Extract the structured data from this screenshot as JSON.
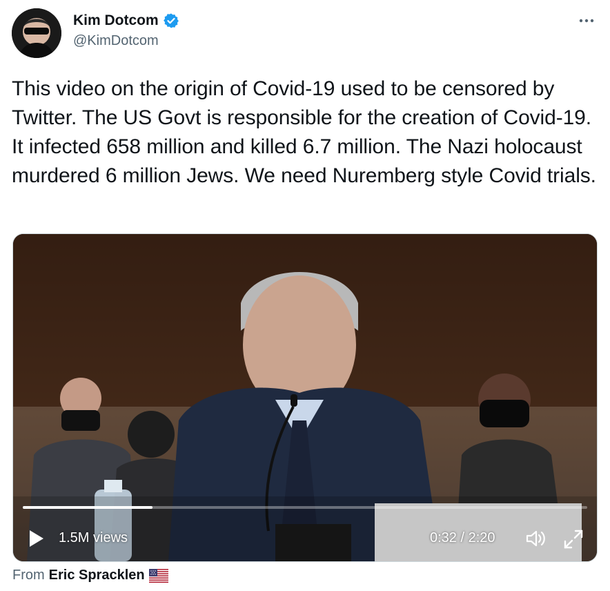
{
  "author": {
    "display_name": "Kim Dotcom",
    "handle": "@KimDotcom",
    "verified": true,
    "avatar_icon": "avatar-image"
  },
  "tweet": {
    "text": "This video on the origin of Covid-19 used to be censored by Twitter. The US Govt is responsible for the creation of Covid-19. It infected 658 million and killed 6.7 million. The Nazi holocaust murdered 6 million Jews. We need Nuremberg style Covid trials."
  },
  "video": {
    "views": "1.5M views",
    "timecode": "0:32 / 2:20",
    "progress_fraction": 0.23,
    "play_icon": "play-icon",
    "volume_icon": "volume-icon",
    "fullscreen_icon": "fullscreen-icon"
  },
  "attribution": {
    "prefix": "From",
    "name": "Eric Spracklen",
    "flag_icon": "us-flag-icon"
  },
  "colors": {
    "text_primary": "#0f1419",
    "text_secondary": "#536471",
    "verified_blue": "#1d9bf0",
    "border": "#cfd9de"
  }
}
